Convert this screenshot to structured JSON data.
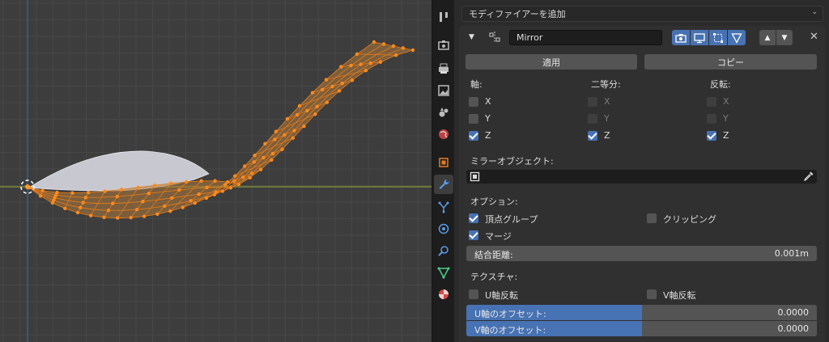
{
  "properties": {
    "add_modifier_label": "モディファイアーを追加",
    "modifier": {
      "name": "Mirror",
      "apply_label": "適用",
      "copy_label": "コピー",
      "axis_header": "軸:",
      "bisect_header": "二等分:",
      "flip_header": "反転:",
      "axes": [
        {
          "label": "X",
          "axis": false,
          "bisect": false,
          "flip": false
        },
        {
          "label": "Y",
          "axis": false,
          "bisect": false,
          "flip": false
        },
        {
          "label": "Z",
          "axis": true,
          "bisect": true,
          "flip": true
        }
      ],
      "mirror_object_label": "ミラーオブジェクト:",
      "mirror_object_value": "",
      "options_header": "オプション:",
      "vertex_groups_label": "頂点グループ",
      "vertex_groups_checked": true,
      "clipping_label": "クリッピング",
      "clipping_checked": false,
      "merge_label": "マージ",
      "merge_checked": true,
      "merge_distance_label": "結合距離:",
      "merge_distance_value": "0.001m",
      "texture_header": "テクスチャ:",
      "u_flip_label": "U軸反転",
      "u_flip_checked": false,
      "v_flip_label": "V軸反転",
      "v_flip_checked": false,
      "u_offset_label": "U軸のオフセット:",
      "u_offset_value": "0.0000",
      "u_offset_fraction": 0.5,
      "v_offset_label": "V軸のオフセット:",
      "v_offset_value": "0.0000",
      "v_offset_fraction": 0.5
    }
  },
  "tabs": [
    {
      "name": "tool-tab",
      "icon": "tool-icon",
      "active": false
    },
    {
      "name": "render-tab",
      "icon": "camera-icon",
      "active": false
    },
    {
      "name": "output-tab",
      "icon": "printer-icon",
      "active": false
    },
    {
      "name": "view-layer-tab",
      "icon": "image-icon",
      "active": false
    },
    {
      "name": "scene-tab",
      "icon": "scene-icon",
      "active": false
    },
    {
      "name": "world-tab",
      "icon": "world-icon",
      "active": false
    },
    {
      "name": "object-tab",
      "icon": "object-icon",
      "active": false
    },
    {
      "name": "modifier-tab",
      "icon": "wrench-icon",
      "active": true
    },
    {
      "name": "particles-tab",
      "icon": "particles-icon",
      "active": false
    },
    {
      "name": "physics-tab",
      "icon": "physics-icon",
      "active": false
    },
    {
      "name": "constraints-tab",
      "icon": "constraint-icon",
      "active": false
    },
    {
      "name": "data-tab",
      "icon": "mesh-data-icon",
      "active": false
    },
    {
      "name": "material-tab",
      "icon": "material-icon",
      "active": false
    }
  ],
  "colors": {
    "accent": "#4772b3",
    "vertex": "#ff8a1c",
    "edge_selected": "#e07a1a",
    "face_selected": "#b07a3c",
    "face_unselected": "#c8c8d0",
    "x_axis": "#8a9a3a",
    "z_axis": "#2f6ab0"
  }
}
